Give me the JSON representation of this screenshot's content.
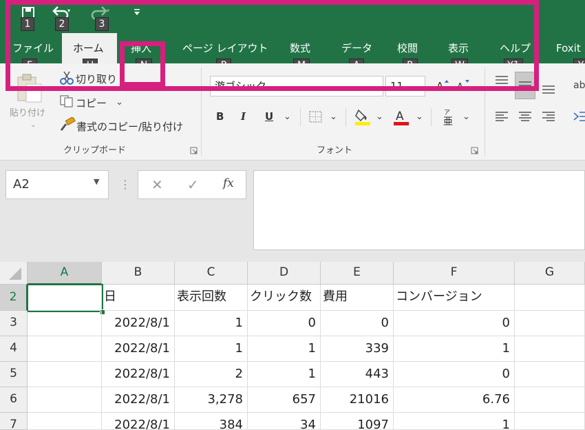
{
  "qat": {
    "keytips": [
      "1",
      "2",
      "3"
    ]
  },
  "tabs": [
    {
      "label": "ファイル",
      "keytip": "F"
    },
    {
      "label": "ホーム",
      "keytip": "H"
    },
    {
      "label": "挿入",
      "keytip": "N"
    },
    {
      "label": "ページ レイアウト",
      "keytip": "P"
    },
    {
      "label": "数式",
      "keytip": "M"
    },
    {
      "label": "データ",
      "keytip": "A"
    },
    {
      "label": "校閲",
      "keytip": "R"
    },
    {
      "label": "表示",
      "keytip": "W"
    },
    {
      "label": "ヘルプ",
      "keytip": "Y1"
    },
    {
      "label": "Foxit",
      "keytip": "Y"
    }
  ],
  "clipboard": {
    "paste_label": "貼り付け",
    "cut_label": "切り取り",
    "copy_label": "コピー",
    "format_painter_label": "書式のコピー/貼り付け",
    "group_label": "クリップボード"
  },
  "font": {
    "font_name": "游ゴシック",
    "font_size": "11",
    "bold": "B",
    "italic": "I",
    "underline": "U",
    "group_label": "フォント"
  },
  "formula_bar": {
    "name_box": "A2",
    "cancel": "✕",
    "enter": "✓",
    "fx": "fx",
    "value": ""
  },
  "sheet": {
    "columns": [
      "A",
      "B",
      "C",
      "D",
      "E",
      "F",
      "G"
    ],
    "rows": [
      {
        "num": "2",
        "cells": [
          "",
          "日",
          "表示回数",
          "クリック数",
          "費用",
          "コンバージョン",
          ""
        ]
      },
      {
        "num": "3",
        "cells": [
          "",
          "2022/8/1",
          "1",
          "0",
          "0",
          "0",
          ""
        ]
      },
      {
        "num": "4",
        "cells": [
          "",
          "2022/8/1",
          "1",
          "1",
          "339",
          "1",
          ""
        ]
      },
      {
        "num": "5",
        "cells": [
          "",
          "2022/8/1",
          "2",
          "1",
          "443",
          "0",
          ""
        ]
      },
      {
        "num": "6",
        "cells": [
          "",
          "2022/8/1",
          "3,278",
          "657",
          "21016",
          "6.76",
          ""
        ]
      },
      {
        "num": "7",
        "cells": [
          "",
          "2022/8/1",
          "384",
          "34",
          "1097",
          "1",
          ""
        ]
      }
    ]
  },
  "colors": {
    "excel_green": "#217346",
    "highlight": "#d6207e"
  }
}
